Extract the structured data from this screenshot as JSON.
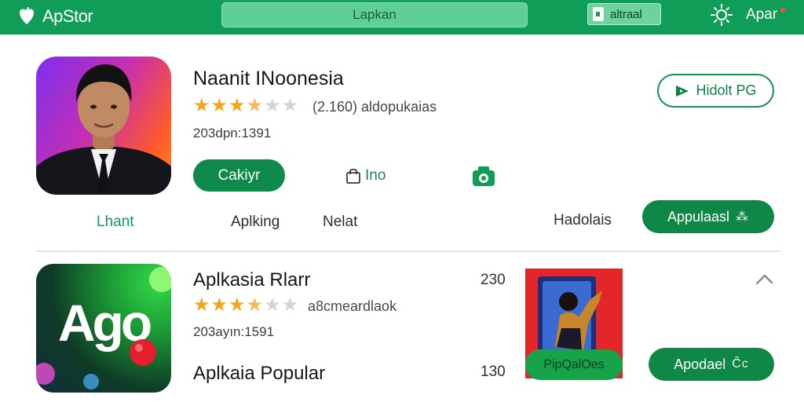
{
  "header": {
    "brand": "ApStor",
    "search_text": "Lapkan",
    "account_label": "altraal",
    "apps_label": "Apar",
    "colors": {
      "bar": "#0f9d58"
    }
  },
  "featured": {
    "title": "Naanit INoonesia",
    "rating_stars": 3.5,
    "rating_text": "(2.160) aldopukaias",
    "meta": "203dpn:1391",
    "install_label": "Cakiyr",
    "info_label": "Ino",
    "outline_button": "Hidolt PG"
  },
  "tabs": [
    "Lhant",
    "Aplking",
    "Nelat",
    "Hadolais"
  ],
  "apps_button": {
    "label": "Appulaasl",
    "glyph": "⁂"
  },
  "listing": {
    "title": "Aplkasia Rlarr",
    "rating_stars": 3.5,
    "rating_text": "a8cmeardlaok",
    "meta": "203ayın:1591",
    "subtitle": "Aplkaia Popular",
    "count_top": "230",
    "count_bottom": "130",
    "logo_text": "Ago",
    "promo_button": "PipQalOes",
    "update_button": "Apodael",
    "update_glyph": "Ĉc"
  }
}
